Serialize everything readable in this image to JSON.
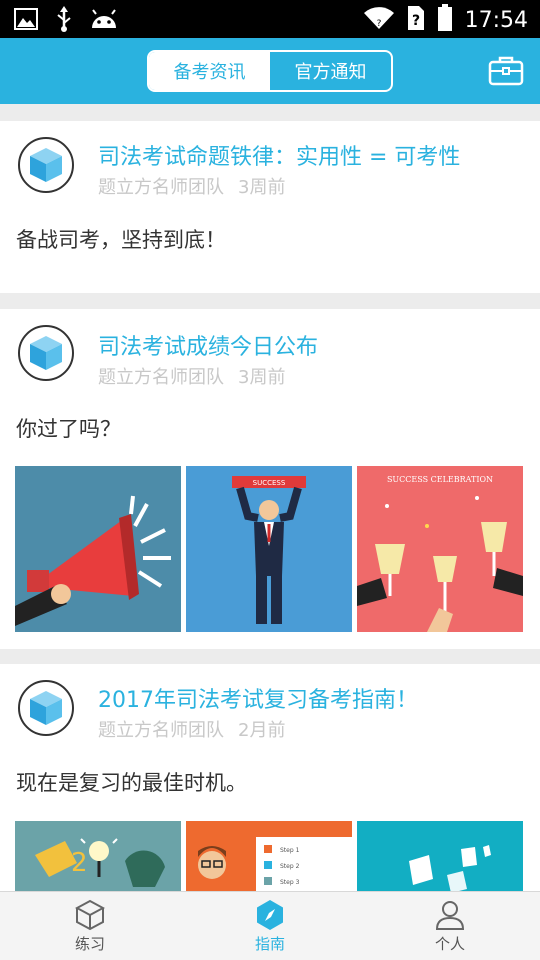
{
  "status_bar": {
    "time": "17:54"
  },
  "header": {
    "tabs": [
      {
        "label": "备考资讯",
        "active": true
      },
      {
        "label": "官方通知",
        "active": false
      }
    ],
    "briefcase_icon": "briefcase-icon"
  },
  "feed": [
    {
      "title": "司法考试命题铁律：实用性 = 可考性",
      "author": "题立方名师团队",
      "time": "3周前",
      "body": "备战司考，坚持到底！",
      "images": []
    },
    {
      "title": "司法考试成绩今日公布",
      "author": "题立方名师团队",
      "time": "3周前",
      "body": "你过了吗？",
      "images": [
        {
          "name": "megaphone-image"
        },
        {
          "name": "success-man-image",
          "text": "SUCCESS"
        },
        {
          "name": "celebration-image",
          "text": "SUCCESS CELEBRATION"
        }
      ]
    },
    {
      "title": "2017年司法考试复习备考指南！",
      "author": "题立方名师团队",
      "time": "2月前",
      "body": "现在是复习的最佳时机。",
      "images": [
        {
          "name": "lightbulb-image"
        },
        {
          "name": "presentation-image",
          "steps": [
            "Step 1",
            "Step 2",
            "Step 3"
          ]
        },
        {
          "name": "papers-image"
        }
      ]
    }
  ],
  "bottom_nav": [
    {
      "label": "练习",
      "icon": "cube-icon",
      "active": false
    },
    {
      "label": "指南",
      "icon": "compass-icon",
      "active": true
    },
    {
      "label": "个人",
      "icon": "person-icon",
      "active": false
    }
  ],
  "colors": {
    "accent": "#2ab2df",
    "meta_text": "#c8c8c8",
    "body_text": "#333333"
  }
}
